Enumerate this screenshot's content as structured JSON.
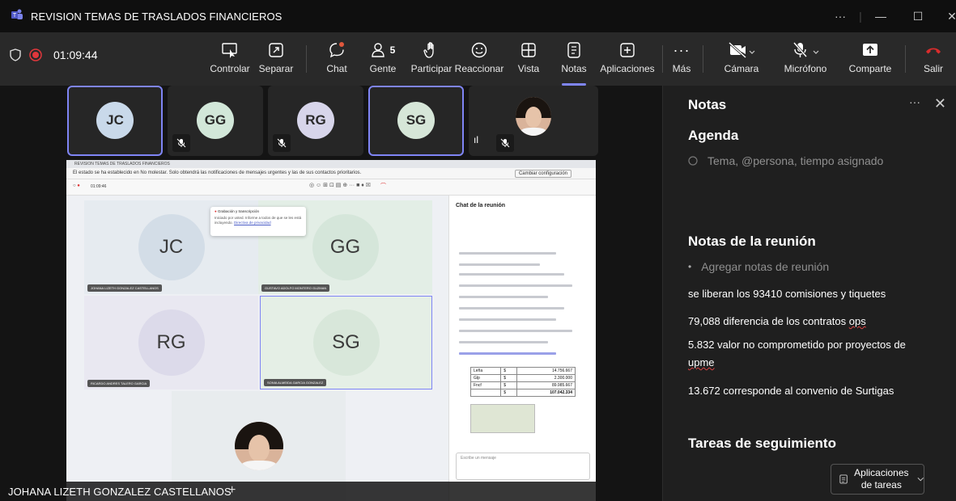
{
  "titlebar": {
    "title": "REVISION TEMAS DE TRASLADOS FINANCIEROS",
    "more": "···",
    "minimize": "—",
    "maximize": "☐",
    "close": "✕"
  },
  "toolbar": {
    "timer": "01:09:44",
    "people_count": "5",
    "buttons": {
      "controlar": "Controlar",
      "separar": "Separar",
      "chat": "Chat",
      "gente": "Gente",
      "participar": "Participar",
      "reaccionar": "Reaccionar",
      "vista": "Vista",
      "notas": "Notas",
      "aplicaciones": "Aplicaciones",
      "mas": "Más",
      "camara": "Cámara",
      "microfono": "Micrófono",
      "comparte": "Comparte",
      "salir": "Salir"
    }
  },
  "participants": [
    {
      "initials": "JC",
      "color": "#c9d9ea"
    },
    {
      "initials": "GG",
      "color": "#d2e7d9"
    },
    {
      "initials": "RG",
      "color": "#d7d5ea"
    },
    {
      "initials": "SG",
      "color": "#d6e6d8"
    }
  ],
  "shared_screen": {
    "window_title": "REVISION TEMAS DE TRASLADOS FINANCIEROS",
    "banner": "El estado se ha establecido en No molestar. Solo obtendrá las notificaciones de mensajes urgentes y las de sus contactos prioritarios.",
    "banner_btn": "Cambiar configuración",
    "timer": "01:09:46",
    "recording_popup_title": "Grabación y transcripción",
    "recording_popup_text": "Iniciado por usted. Informe a todos de que se les está incluyendo.",
    "recording_popup_link": "Directiva de privacidad",
    "tiles": [
      {
        "initials": "JC",
        "name": "JOHANA LIZETH GONZALEZ CASTELLANOS"
      },
      {
        "initials": "GG",
        "name": "GUSTAVO ADOLFO MONTERO GUZMAN"
      },
      {
        "initials": "RG",
        "name": "RICARDO ANDRES TALERO GARCIA"
      },
      {
        "initials": "SG",
        "name": "SONIA ALMEIDA GARCIA GONZALEZ"
      }
    ],
    "chat_title": "Chat de la reunión",
    "chat_table": [
      {
        "label": "Leña",
        "cur": "$",
        "value": "14.756.667"
      },
      {
        "label": "Glp",
        "cur": "$",
        "value": "2.300.000"
      },
      {
        "label": "Fncf",
        "cur": "$",
        "value": "89.985.667"
      },
      {
        "label": "",
        "cur": "$",
        "value": "107.042.334"
      }
    ],
    "chat_input": "Escribe un mensaje"
  },
  "bottom_name": "JOHANA LIZETH GONZALEZ CASTELLANOS",
  "notes": {
    "title": "Notas",
    "more": "···",
    "close": "✕",
    "agenda_heading": "Agenda",
    "agenda_placeholder": "Tema, @persona, tiempo asignado",
    "meeting_notes_heading": "Notas de la reunión",
    "meeting_notes_placeholder": "Agregar notas de reunión",
    "lines": [
      "se liberan los 93410 comisiones y tiquetes",
      "79,088 diferencia de los contratos",
      "ops",
      "5.832 valor no comprometido por proyectos de",
      "upme",
      "13.672 corresponde al convenio de Surtigas"
    ],
    "followup_heading": "Tareas de seguimiento",
    "task_button_line1": "Aplicaciones",
    "task_button_line2": "de tareas"
  },
  "colors": {
    "accent": "#7f85f5",
    "record_red": "#e0373c",
    "leave_red": "#d92c2c"
  }
}
